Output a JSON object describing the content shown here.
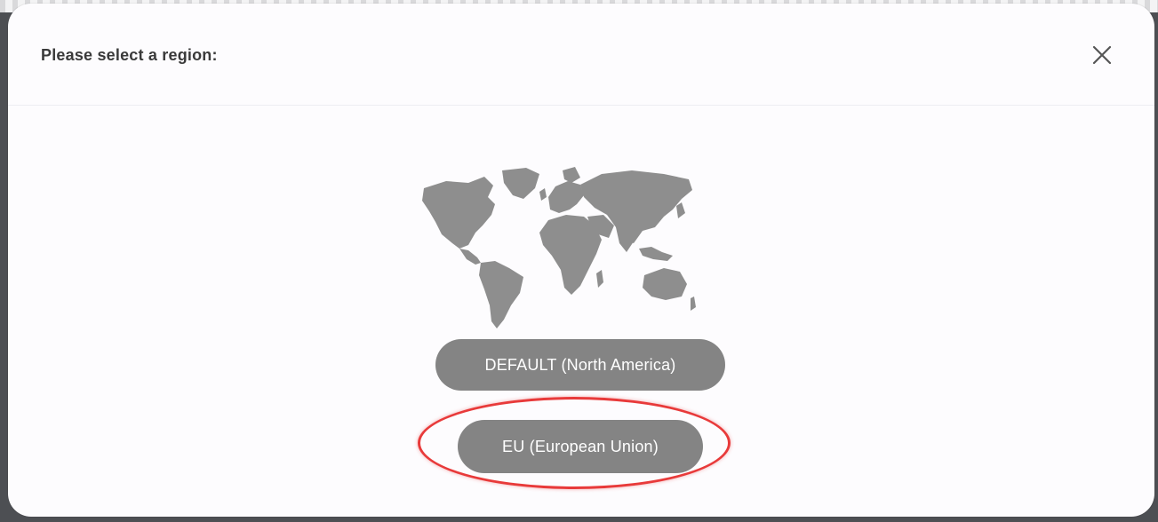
{
  "dialog": {
    "title": "Please select a region:",
    "close_icon": "close-icon"
  },
  "map": {
    "icon": "world-map-icon",
    "color": "#8e8e8e"
  },
  "regions": [
    {
      "label": "DEFAULT (North America)"
    },
    {
      "label": "EU (European Union)",
      "highlighted": true
    }
  ],
  "colors": {
    "button_bg": "#848484",
    "button_text": "#ffffff",
    "highlight": "#e83a3a"
  }
}
